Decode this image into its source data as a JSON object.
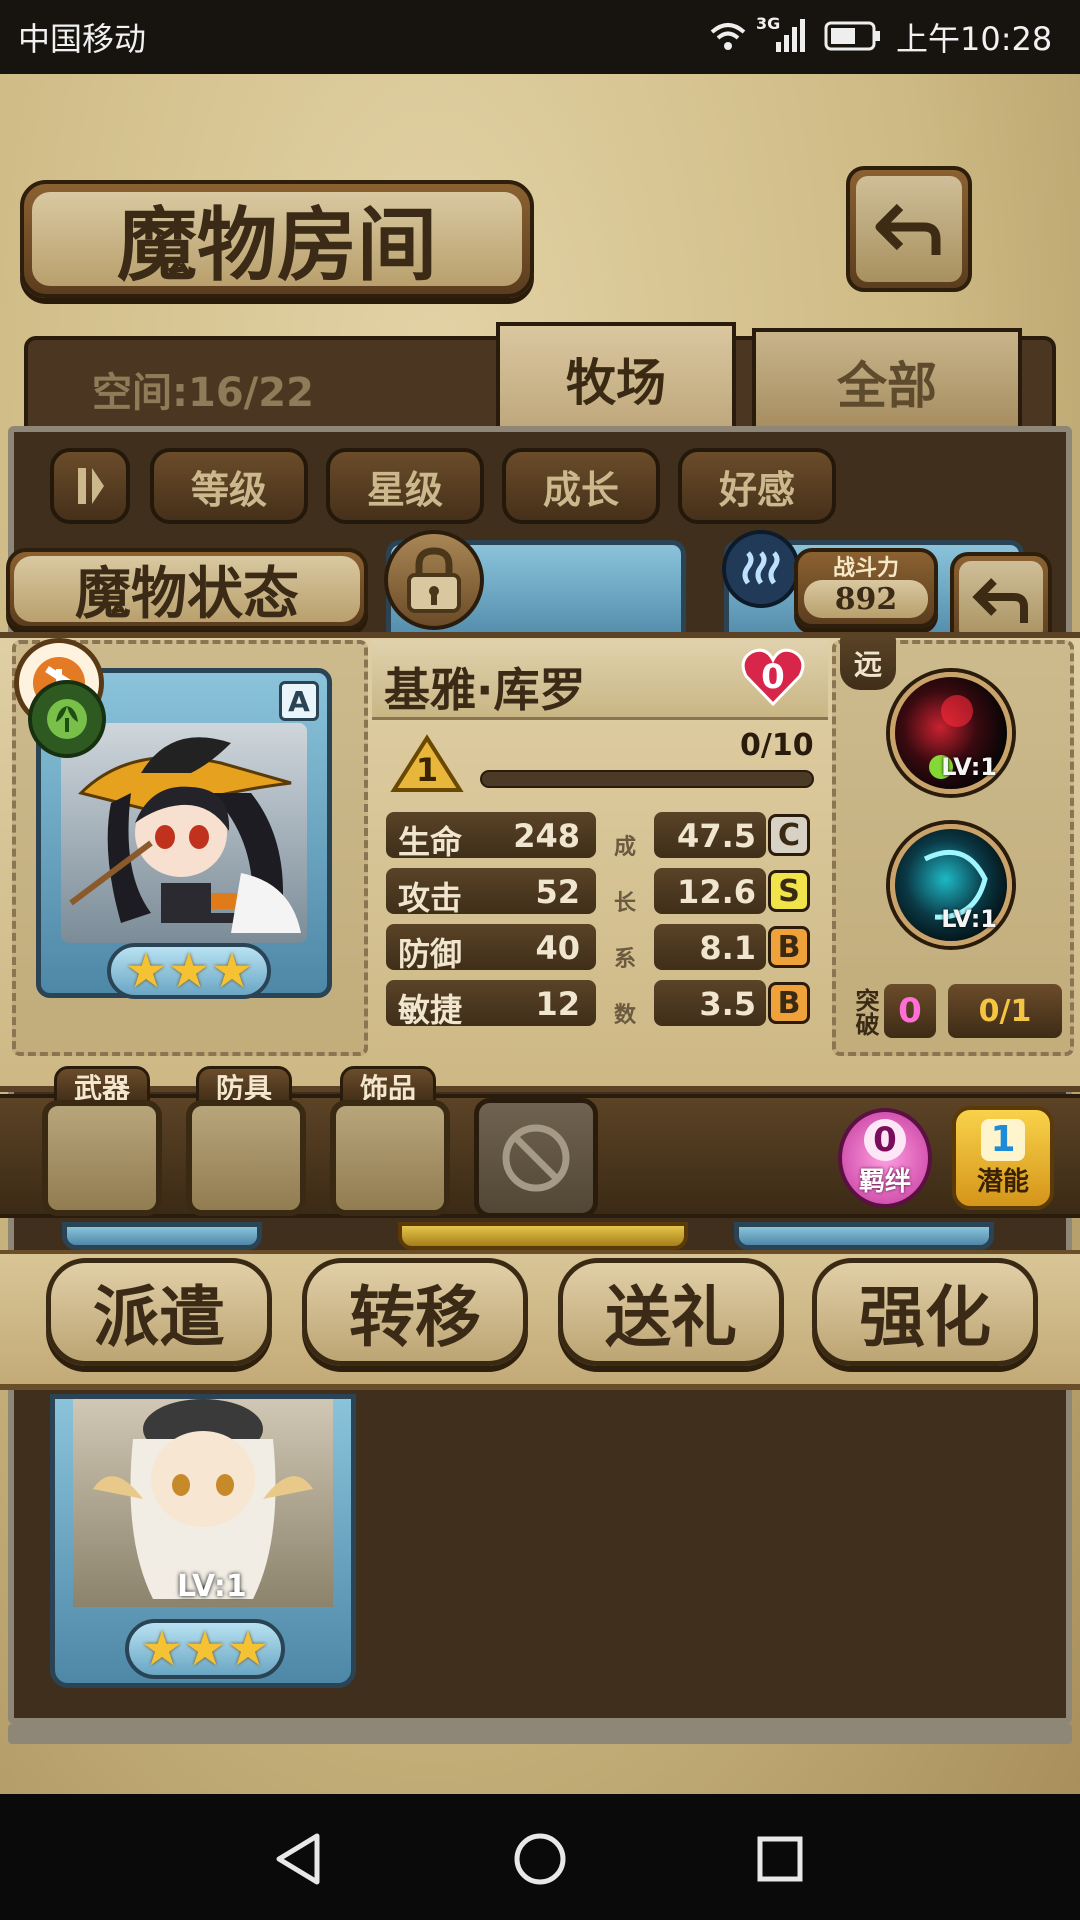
{
  "status_bar": {
    "carrier": "中国移动",
    "network": "3G",
    "time": "上午10:28"
  },
  "header": {
    "title": "魔物房间",
    "space_label": "空间:16/22"
  },
  "tabs": [
    {
      "label": "牧场"
    },
    {
      "label": "全部"
    }
  ],
  "filters": [
    {
      "label": "等级"
    },
    {
      "label": "星级"
    },
    {
      "label": "成长"
    },
    {
      "label": "好感"
    }
  ],
  "status_panel": {
    "title": "魔物状态",
    "combat_power_label": "战斗力",
    "combat_power": "892",
    "range_tag": "远"
  },
  "monster": {
    "name": "基雅·库罗",
    "heart_count": "0",
    "rank": "A",
    "level_badge": "1",
    "exp": "0/10",
    "exp_fraction": 0,
    "stars": 3,
    "growth_label": [
      "成",
      "长",
      "系",
      "数"
    ],
    "stats": [
      {
        "label": "生命",
        "value": "248",
        "growth": "47.5",
        "grade": "C"
      },
      {
        "label": "攻击",
        "value": "52",
        "growth": "12.6",
        "grade": "S"
      },
      {
        "label": "防御",
        "value": "40",
        "growth": "8.1",
        "grade": "B"
      },
      {
        "label": "敏捷",
        "value": "12",
        "growth": "3.5",
        "grade": "B"
      }
    ]
  },
  "skills": [
    {
      "level": "LV:1",
      "icon": "dark-orb-icon"
    },
    {
      "level": "LV:1",
      "icon": "cyan-vortex-icon"
    }
  ],
  "breakthrough": {
    "label": "突破",
    "count": "0",
    "progress": "0/1"
  },
  "equipment": [
    {
      "label": "武器"
    },
    {
      "label": "防具"
    },
    {
      "label": "饰品"
    }
  ],
  "bond": {
    "count": "0",
    "label": "羁绊"
  },
  "potential": {
    "count": "1",
    "label": "潜能"
  },
  "actions": [
    {
      "label": "派遣"
    },
    {
      "label": "转移"
    },
    {
      "label": "送礼"
    },
    {
      "label": "强化"
    }
  ],
  "lower_card": {
    "level": "LV:1",
    "stars": 3
  },
  "colors": {
    "accent": "#5b3d1e",
    "parchment": "#d9c8a1",
    "card_blue": "#6aa6c4"
  }
}
